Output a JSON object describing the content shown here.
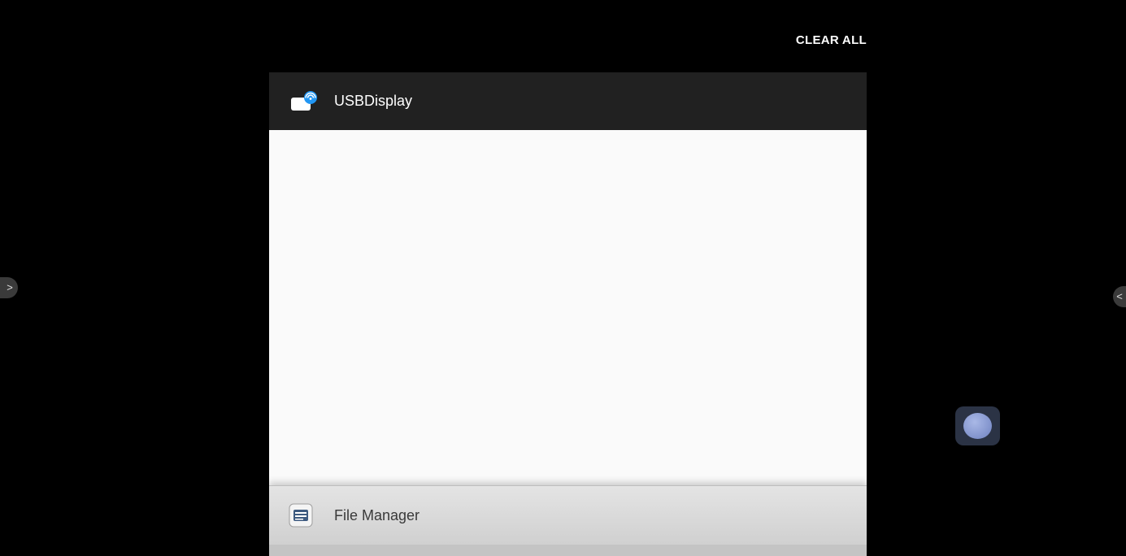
{
  "recents": {
    "clear_all_label": "CLEAR ALL",
    "cards": [
      {
        "app_name": "USBDisplay",
        "icon": "usb-display-icon"
      },
      {
        "app_name": "File Manager",
        "icon": "file-manager-icon"
      }
    ]
  },
  "edge_handles": {
    "left_glyph": ">",
    "right_glyph": "<"
  },
  "floating_button": {
    "icon": "assistive-touch-icon"
  },
  "colors": {
    "background": "#000000",
    "card_header_dark": "#212121",
    "card_body": "#fafafa",
    "accent_blue": "#2196f3",
    "floating_button_bg": "#2b3345"
  }
}
